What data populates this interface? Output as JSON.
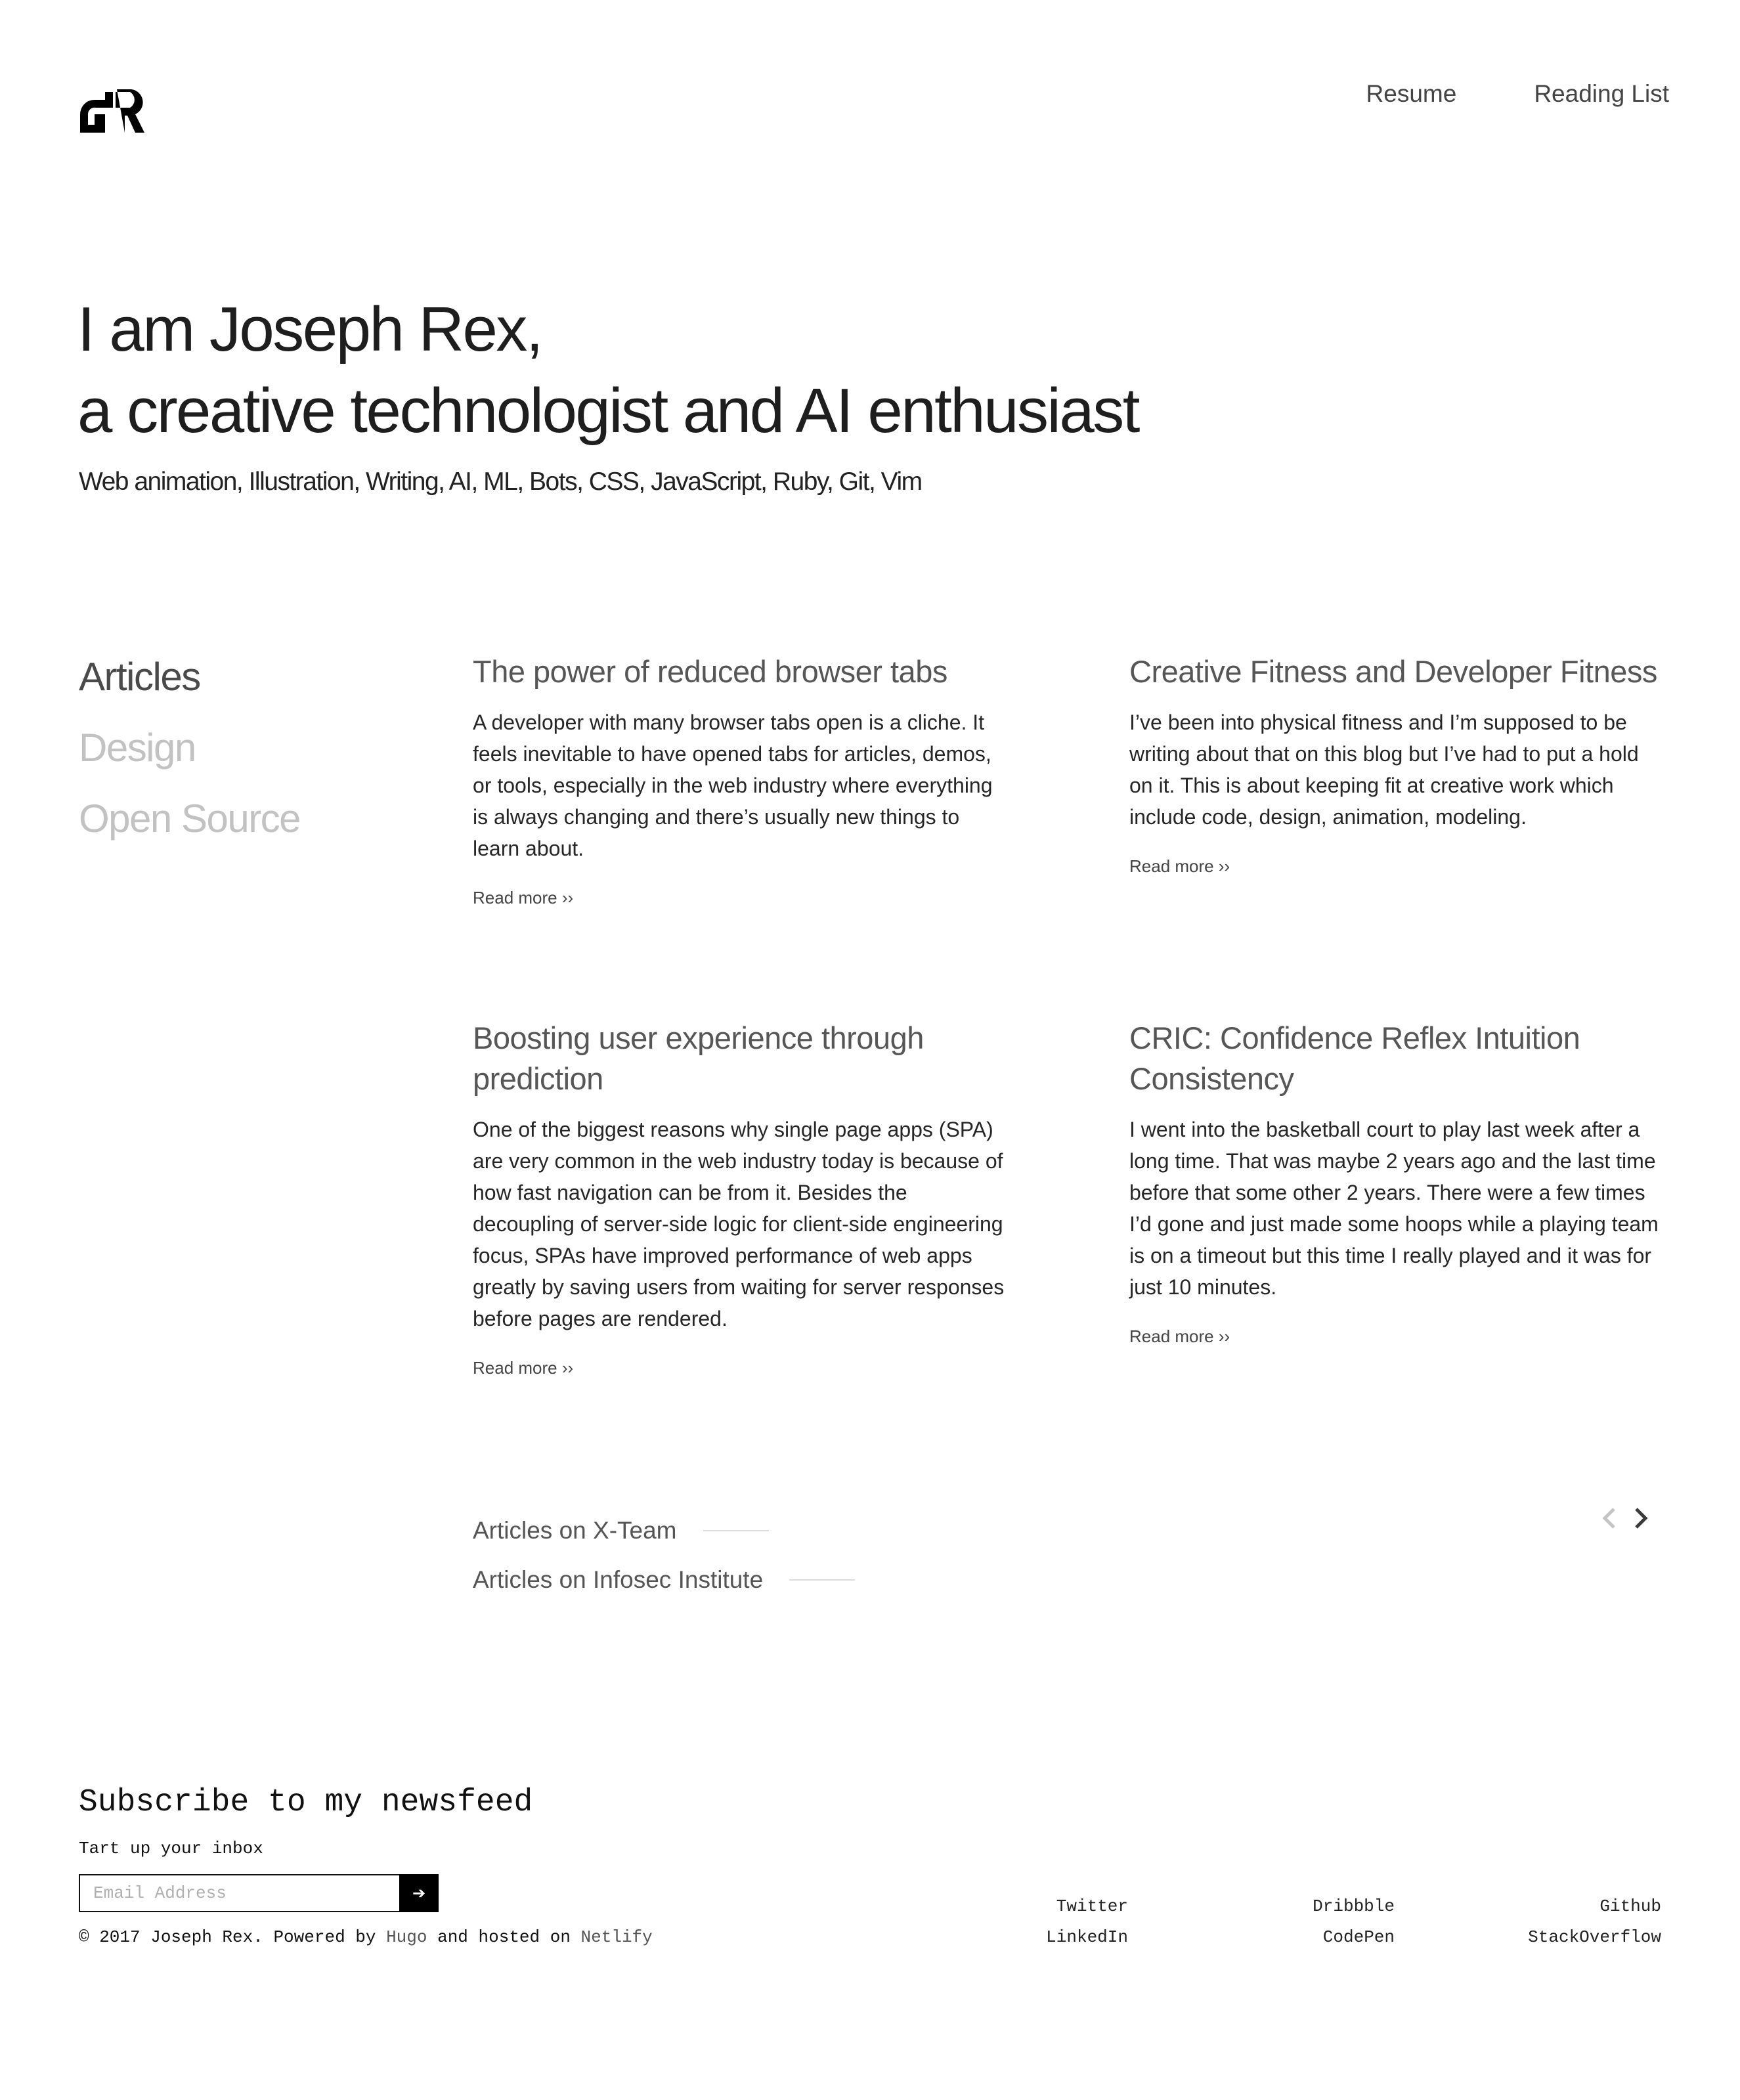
{
  "header": {
    "logo_text": "JR",
    "nav": [
      "Resume",
      "Reading List"
    ]
  },
  "hero": {
    "line1": "I am Joseph Rex,",
    "line2": "a creative technologist and AI enthusiast",
    "tags": "Web animation, Illustration, Writing, AI, ML, Bots, CSS, JavaScript, Ruby, Git, Vim"
  },
  "categories": [
    {
      "label": "Articles",
      "active": true
    },
    {
      "label": "Design",
      "active": false
    },
    {
      "label": "Open Source",
      "active": false
    }
  ],
  "articles": [
    {
      "title": "The power of reduced browser tabs",
      "excerpt": "A developer with many browser tabs open is a cliche. It feels inevitable to have opened tabs for articles, demos, or tools, especially in the web industry where everything is always changing and there’s usually new things to learn about.",
      "read_more": "Read more ››"
    },
    {
      "title": "Creative Fitness and Developer Fitness",
      "excerpt": "I’ve been into physical fitness and I’m supposed to be writing about that on this blog but I’ve had to put a hold on it. This is about keeping fit at creative work which include code, design, animation, modeling.",
      "read_more": "Read more ››"
    },
    {
      "title": "Boosting user experience through prediction",
      "excerpt": "One of the biggest reasons why single page apps (SPA) are very common in the web industry today is because of how fast navigation can be from it. Besides the decoupling of server-side logic for client-side engineering focus, SPAs have improved performance of web apps greatly by saving users from waiting for server responses before pages are rendered.",
      "read_more": "Read more ››"
    },
    {
      "title": "CRIC: Confidence Reflex Intuition Consistency",
      "excerpt": "I went into the basketball court to play last week after a long time. That was maybe 2 years ago and the last time before that some other 2 years. There were a few times I’d gone and just made some hoops while a playing team is on a timeout but this time I really played and it was for just 10 minutes.",
      "read_more": "Read more ››"
    }
  ],
  "external_links": [
    "Articles on X-Team",
    "Articles on Infosec Institute"
  ],
  "pager": {
    "prev_icon": "chevron-left-icon",
    "next_icon": "chevron-right-icon"
  },
  "subscribe": {
    "title": "Subscribe to my newsfeed",
    "subtitle": "Tart up your inbox",
    "placeholder": "Email Address",
    "submit_icon": "➔"
  },
  "footer": {
    "copyright_prefix": "© 2017 Joseph Rex. Powered by ",
    "hugo": "Hugo",
    "middle": " and hosted on ",
    "netlify": "Netlify",
    "social": [
      "Twitter",
      "Dribbble",
      "Github",
      "LinkedIn",
      "CodePen",
      "StackOverflow"
    ]
  },
  "colors": {
    "text": "#1f1f1f",
    "muted": "#c2c2c2",
    "heading": "#565656",
    "line": "#dcdcdc",
    "button_bg": "#000000"
  }
}
